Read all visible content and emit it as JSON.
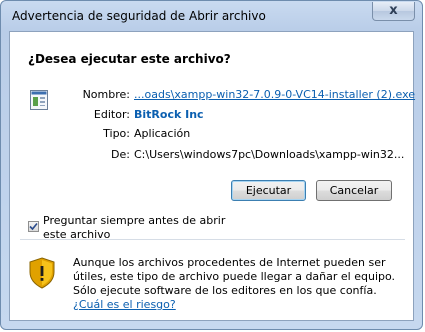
{
  "window": {
    "title": "Advertencia de seguridad de Abrir archivo",
    "close_glyph": "x"
  },
  "dialog": {
    "question": "¿Desea ejecutar este archivo?",
    "fields": {
      "name_label": "Nombre:",
      "name_value": "...oads\\xampp-win32-7.0.9-0-VC14-installer (2).exe",
      "publisher_label": "Editor:",
      "publisher_value": "BitRock Inc",
      "type_label": "Tipo:",
      "type_value": "Aplicación",
      "from_label": "De:",
      "from_value": "C:\\Users\\windows7pc\\Downloads\\xampp-win32..."
    },
    "buttons": {
      "run": "Ejecutar",
      "cancel": "Cancelar"
    },
    "checkbox": {
      "label": "Preguntar siempre antes de abrir este archivo",
      "checked": true
    },
    "warning": {
      "text": "Aunque los archivos procedentes de Internet pueden ser útiles, este tipo de archivo puede llegar a dañar el equipo. Sólo ejecute software de los editores en los que confía.",
      "link": "¿Cuál es el riesgo?"
    }
  },
  "icons": {
    "file": "application-file-icon",
    "shield": "security-shield-icon",
    "close": "close-icon",
    "check": "checkmark-icon"
  }
}
